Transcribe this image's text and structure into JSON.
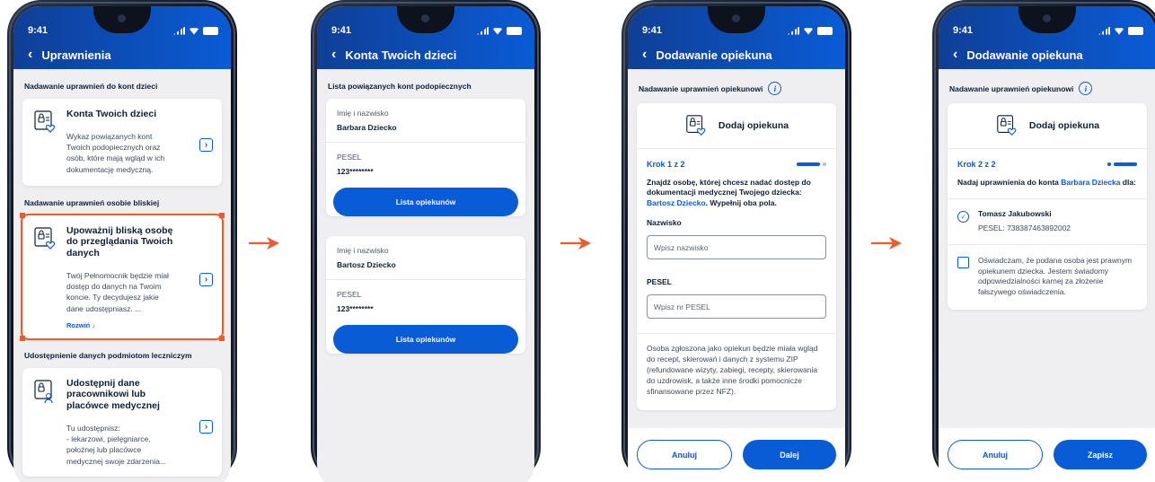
{
  "status": {
    "time": "9:41"
  },
  "colors": {
    "primary": "#0a5bd6",
    "highlight": "#f05a28",
    "appbar_dark": "#0f3f96"
  },
  "icons": {
    "back": "chevron-left-icon",
    "chevron": "chevron-right-icon",
    "info": "info-icon",
    "document": "document-lock-heart-icon",
    "arrow": "orange-arrow-icon"
  },
  "screen1": {
    "title": "Uprawnienia",
    "section1": "Nadawanie uprawnień do kont dzieci",
    "card1_title": "Konta Twoich dzieci",
    "card1_desc": "Wykaz powiązanych kont Twoich podopiecznych oraz osób, które mają wgląd w ich dokumentację medyczną.",
    "section2": "Nadawanie uprawnień osobie bliskiej",
    "card2_title": "Upoważnij bliską osobę do przeglądania Twoich danych",
    "card2_desc": "Twój Pełnomocnik będzie miał dostęp do danych na Twoim koncie. Ty decydujesz jakie dane udostępniasz. ...",
    "card2_more": "Rozwiń ↓",
    "section3": "Udostępnienie danych podmiotom leczniczym",
    "card3_title": "Udostępnij dane pracownikowi lub placówce medycznej",
    "card3_desc": "Tu udostępnisz:\n- lekarzowi, pielęgniarce, położnej lub placówce medycznej swoje zdarzenia..."
  },
  "screen2": {
    "title": "Konta Twoich dzieci",
    "section": "Lista powiązanych kont podopiecznych",
    "children": [
      {
        "name_label": "Imię i nazwisko",
        "name": "Barbara Dziecko",
        "pesel_label": "PESEL",
        "pesel": "123********",
        "button": "Lista opiekunów"
      },
      {
        "name_label": "Imię i nazwisko",
        "name": "Bartosz Dziecko",
        "pesel_label": "PESEL",
        "pesel": "123********",
        "button": "Lista opiekunów"
      }
    ]
  },
  "screen3": {
    "title": "Dodawanie opiekuna",
    "section": "Nadawanie uprawnień opiekunowi",
    "card_title": "Dodaj opiekuna",
    "step": "Krok 1 z 2",
    "progress": 0.5,
    "instruction_pre": "Znajdź osobę, której chcesz nadać dostęp do dokumentacji medycznej Twojego dziecka: ",
    "instruction_child": "Bartosz Dziecko",
    "instruction_post": ". Wypełnij oba pola.",
    "surname_label": "Nazwisko",
    "surname_placeholder": "Wpisz nazwisko",
    "pesel_label": "PESEL",
    "pesel_placeholder": "Wpisz nr PESEL",
    "note": "Osoba zgłoszona jako opiekun będzie miała wgląd do recept, skierowań i danych z systemu ZIP (refundowane wizyty, zabiegi, recepty, skierowania do uzdrowisk, a także inne środki pomocnicze sfinansowane przez NFZ).",
    "cancel": "Anuluj",
    "next": "Dalej"
  },
  "screen4": {
    "title": "Dodawanie opiekuna",
    "section": "Nadawanie uprawnień opiekunowi",
    "card_title": "Dodaj opiekuna",
    "step": "Krok 2 z 2",
    "progress": 1.0,
    "grant_pre": "Nadaj uprawnienia do konta ",
    "grant_child": "Barbara Dziecka",
    "grant_post": " dla:",
    "person_name": "Tomasz Jakubowski",
    "person_pesel": "PESEL: 738387463892002",
    "declaration": "Oświadczam, że podana osoba jest prawnym opiekunem dziecka. Jestem świadomy odpowiedzialności karnej za złożenie fałszywego oświadczenia.",
    "cancel": "Anuluj",
    "save": "Zapisz"
  }
}
